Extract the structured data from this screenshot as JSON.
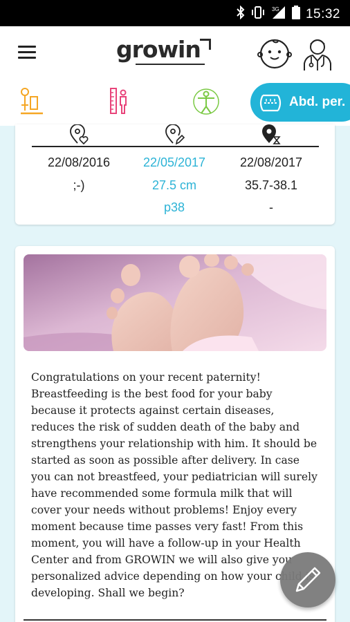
{
  "status_bar": {
    "time": "15:32",
    "network_label": "3G",
    "icons": [
      "bluetooth-icon",
      "vibrate-icon",
      "signal-icon",
      "battery-icon"
    ]
  },
  "app_bar": {
    "logo_text": "growin",
    "icons": [
      "menu-icon",
      "baby-profile-icon",
      "doctor-icon"
    ]
  },
  "tabs": [
    {
      "name": "weight-icon",
      "color": "#f5a623"
    },
    {
      "name": "height-icon",
      "color": "#e8437a"
    },
    {
      "name": "body-icon",
      "color": "#7ac943"
    },
    {
      "name": "abdominal-perimeter-icon",
      "label": "Abd. per.",
      "active": true,
      "color": "#22b4d8"
    }
  ],
  "measurements": {
    "columns": [
      {
        "icon": "birth-location-icon",
        "date": "22/08/2016",
        "value": ";-)",
        "percentile": ""
      },
      {
        "icon": "edit-location-icon",
        "date": "22/05/2017",
        "value": "27.5 cm",
        "percentile": "p38",
        "highlight": true
      },
      {
        "icon": "next-checkup-icon",
        "date": "22/08/2017",
        "value": "35.7-38.1",
        "percentile": "-"
      }
    ]
  },
  "article": {
    "image": "baby-feet-photo",
    "text": "Congratulations on your recent paternity! Breastfeeding is the best food for your baby because it protects against certain diseases, reduces the risk of sudden death of the baby and strengthens your relationship with him. It should be started as soon as possible after delivery. In case you can not breastfeed, your pediatrician will surely have recommended some formula milk that will cover your needs without problems! Enjoy every moment because time passes very fast! From this moment, you will have a follow-up in your Health Center and from GROWIN we will also give you personalized advice depending on how your child is developing. Shall we begin?"
  },
  "fab": {
    "icon": "pencil-icon"
  }
}
